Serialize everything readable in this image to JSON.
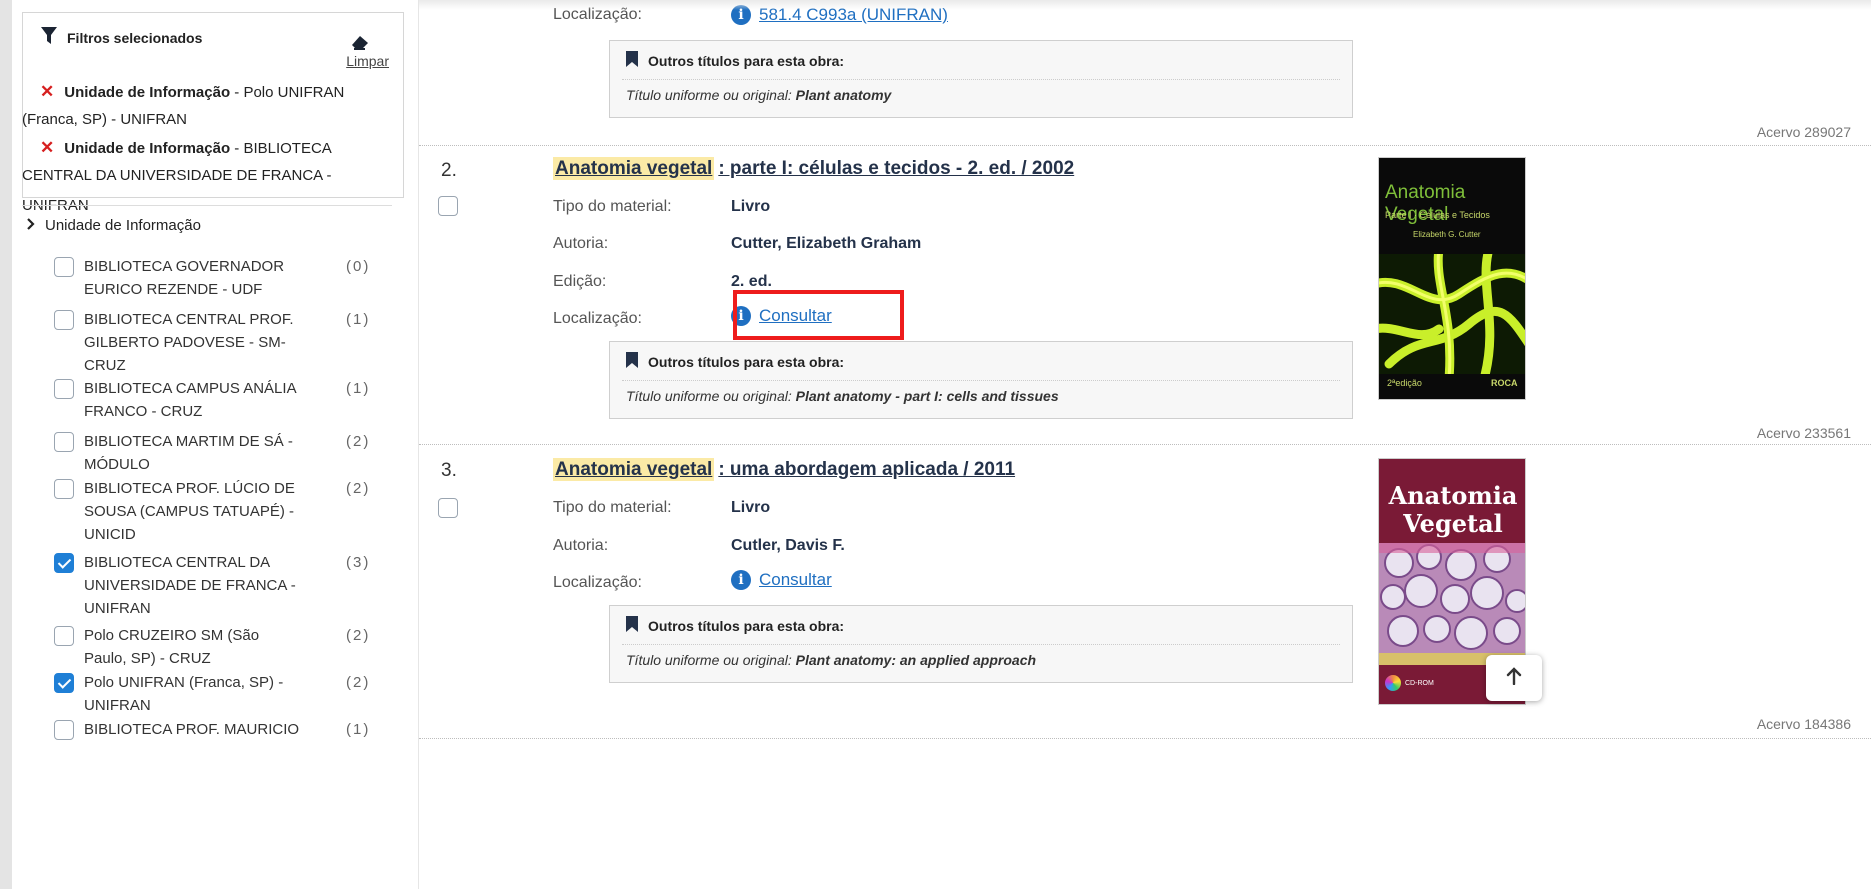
{
  "filters": {
    "title": "Filtros selecionados",
    "clear_label": "Limpar",
    "selected": [
      {
        "field": "Unidade de Informação",
        "value_line1": " - Polo UNIFRAN",
        "value_line2": "(Franca, SP) - UNIFRAN"
      },
      {
        "field": "Unidade de Informação",
        "value_line1": " - BIBLIOTECA",
        "value_line2": "CENTRAL DA UNIVERSIDADE DE FRANCA - UNIFRAN"
      }
    ]
  },
  "facet": {
    "title": "Unidade de Informação",
    "items": [
      {
        "label": "BIBLIOTECA GOVERNADOR EURICO REZENDE - UDF",
        "count": "(0)",
        "checked": false
      },
      {
        "label": "BIBLIOTECA CENTRAL PROF. GILBERTO PADOVESE - SM-CRUZ",
        "count": "(1)",
        "checked": false
      },
      {
        "label": "BIBLIOTECA CAMPUS ANÁLIA FRANCO - CRUZ",
        "count": "(1)",
        "checked": false
      },
      {
        "label": "BIBLIOTECA MARTIM DE SÁ - MÓDULO",
        "count": "(2)",
        "checked": false
      },
      {
        "label": "BIBLIOTECA PROF. LÚCIO DE SOUSA (CAMPUS TATUAPÉ) - UNICID",
        "count": "(2)",
        "checked": false
      },
      {
        "label": "BIBLIOTECA CENTRAL DA UNIVERSIDADE DE FRANCA - UNIFRAN",
        "count": "(3)",
        "checked": true
      },
      {
        "label": "Polo CRUZEIRO SM (São Paulo, SP) - CRUZ",
        "count": "(2)",
        "checked": false
      },
      {
        "label": "Polo UNIFRAN (Franca, SP) - UNIFRAN",
        "count": "(2)",
        "checked": true
      },
      {
        "label": "BIBLIOTECA PROF. MAURICIO",
        "count": "(1)",
        "checked": false
      }
    ]
  },
  "labels": {
    "tipo": "Tipo do material:",
    "autoria": "Autoria:",
    "edicao": "Edição:",
    "localizacao": "Localização:",
    "outros_titulos": "Outros títulos para esta obra:",
    "titulo_uniforme": "Título uniforme ou original:",
    "consultar": "Consultar"
  },
  "results": [
    {
      "localizacao": "581.4 C993a (UNIFRAN)",
      "uniform_title": "Plant anatomy",
      "acervo": "Acervo 289027"
    },
    {
      "number": "2.",
      "title_highlight": "Anatomia vegetal",
      "title_rest": ": parte I: células e tecidos - 2. ed. / 2002",
      "tipo": "Livro",
      "autoria": "Cutter, Elizabeth Graham",
      "edicao": "2. ed.",
      "uniform_title": "Plant anatomy - part I: cells and tissues",
      "acervo": "Acervo 233561",
      "cover": {
        "line1": "Anatomia Vegetal",
        "line2": "Parte I · Células e Tecidos",
        "line3": "Elizabeth G. Cutter",
        "edition": "2ªedição",
        "publisher": "ROCA"
      }
    },
    {
      "number": "3.",
      "title_highlight": "Anatomia vegetal",
      "title_rest": ": uma abordagem aplicada / 2011",
      "tipo": "Livro",
      "autoria": "Cutler, Davis F.",
      "uniform_title": "Plant anatomy: an applied approach",
      "acervo": "Acervo 184386",
      "cover": {
        "line1": "Anatomia",
        "line2": "Vegetal",
        "cd": "CD-ROM"
      }
    }
  ],
  "colors": {
    "accent": "#1f6fc1",
    "highlight": "#fbeaa6",
    "remove": "#d61f1f",
    "annotation": "#ee1c1c"
  }
}
